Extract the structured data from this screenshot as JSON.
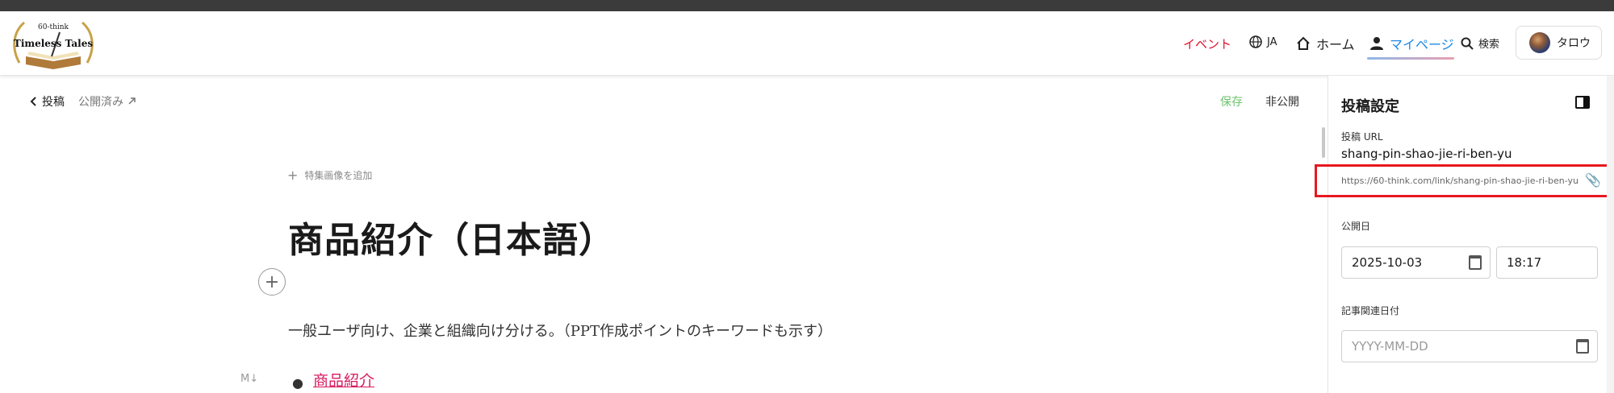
{
  "header": {
    "logo_top": "60-think",
    "logo_main": "Timeless Tales",
    "event": "イベント",
    "lang": "JA",
    "home": "ホーム",
    "mypage": "マイページ",
    "search": "検索",
    "user": "タロウ",
    "colors": {
      "event": "#e0132b",
      "mypage": "#1e88e5"
    }
  },
  "subbar": {
    "back": "投稿",
    "status": "公開済み",
    "save": "保存",
    "unpublish": "非公開"
  },
  "editor": {
    "add_image": "特集画像を追加",
    "title": "商品紹介（日本語）",
    "paragraph": "一般ユーザ向け、企業と組織向け分ける。（PPT作成ポイントのキーワードも示す）",
    "md_badge": "M↓",
    "bullet": "商品紹介"
  },
  "panel": {
    "title": "投稿設定",
    "url_label": "投稿 URL",
    "url_value": "shang-pin-shao-jie-ri-ben-yu",
    "url_link": "https://60-think.com/link/shang-pin-shao-jie-ri-ben-yu",
    "date_label": "公開日",
    "date_value": "2025-10-03",
    "time_value": "18:17",
    "related_label": "記事関連日付",
    "related_placeholder": "YYYY-MM-DD"
  }
}
